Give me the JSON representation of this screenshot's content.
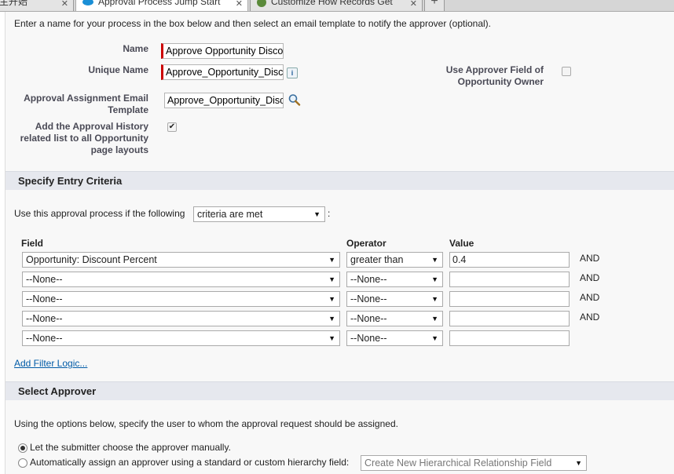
{
  "tabs": [
    {
      "label": "主开始",
      "active": false
    },
    {
      "label": "Approval Process Jump Start",
      "active": true
    },
    {
      "label": "Customize How Records Get",
      "active": false
    }
  ],
  "new_tab_label": "+",
  "intro_text": "Enter a name for your process in the box below and then select an email template to notify the approver (optional).",
  "form": {
    "name_label": "Name",
    "name_value": "Approve Opportunity Discount",
    "unique_name_label": "Unique Name",
    "unique_name_value": "Approve_Opportunity_Discount",
    "info_icon": "i",
    "use_approver_label_1": "Use Approver Field of",
    "use_approver_label_2": "Opportunity Owner",
    "email_template_label_1": "Approval Assignment Email",
    "email_template_label_2": "Template",
    "email_template_value": "Approve_Opportunity_Discount",
    "history_label_1": "Add the Approval History",
    "history_label_2": "related list to all Opportunity",
    "history_label_3": "page layouts",
    "history_checked": true
  },
  "entry_criteria": {
    "section_title": "Specify Entry Criteria",
    "use_prefix": "Use this approval process if the following",
    "criteria_select": "criteria are met",
    "use_suffix": ":",
    "col_field": "Field",
    "col_operator": "Operator",
    "col_value": "Value",
    "rows": [
      {
        "field": "Opportunity: Discount Percent",
        "operator": "greater than",
        "value": "0.4",
        "conj": "AND"
      },
      {
        "field": "--None--",
        "operator": "--None--",
        "value": "",
        "conj": "AND"
      },
      {
        "field": "--None--",
        "operator": "--None--",
        "value": "",
        "conj": "AND"
      },
      {
        "field": "--None--",
        "operator": "--None--",
        "value": "",
        "conj": "AND"
      },
      {
        "field": "--None--",
        "operator": "--None--",
        "value": "",
        "conj": ""
      }
    ],
    "filter_logic_link": "Add Filter Logic..."
  },
  "approver": {
    "section_title": "Select Approver",
    "desc": "Using the options below, specify the user to whom the approval request should be assigned.",
    "option_manual": "Let the submitter choose the approver manually.",
    "option_auto": "Automatically assign an approver using a standard or custom hierarchy field:",
    "hierarchy_select": "Create New Hierarchical Relationship Field"
  },
  "colors": {
    "required": "#cc0000",
    "link": "#015ba7",
    "section_bg": "#e6e8ee"
  }
}
